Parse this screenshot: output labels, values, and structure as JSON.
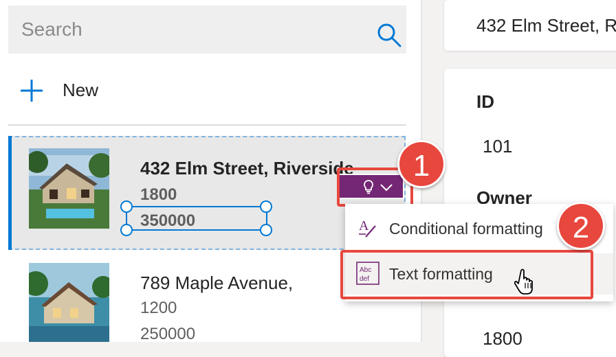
{
  "search": {
    "placeholder": "Search",
    "icon": "search-icon"
  },
  "new_button": {
    "label": "New",
    "icon": "plus-icon"
  },
  "gallery": {
    "items": [
      {
        "title": "432 Elm Street, Riverside",
        "line2": "1800",
        "line3": "350000",
        "selected": true
      },
      {
        "title": "789 Maple Avenue,",
        "line2": "1200",
        "line3": "250000",
        "selected": false
      }
    ]
  },
  "ai_button": {
    "icon": "lightbulb-icon",
    "chevron": "chevron-down-icon",
    "color": "#742774"
  },
  "menu": {
    "items": [
      {
        "label": "Conditional formatting",
        "icon": "conditional-format-icon"
      },
      {
        "label": "Text formatting",
        "icon": "text-format-icon"
      }
    ]
  },
  "badges": [
    "1",
    "2"
  ],
  "detail": {
    "title": "432 Elm Street, R",
    "fields": [
      {
        "label": "ID",
        "value": "101"
      },
      {
        "label": "Owner",
        "value": ""
      }
    ],
    "bottom_value": "1800"
  },
  "colors": {
    "accent": "#0078d4",
    "highlight": "#e8473e"
  }
}
